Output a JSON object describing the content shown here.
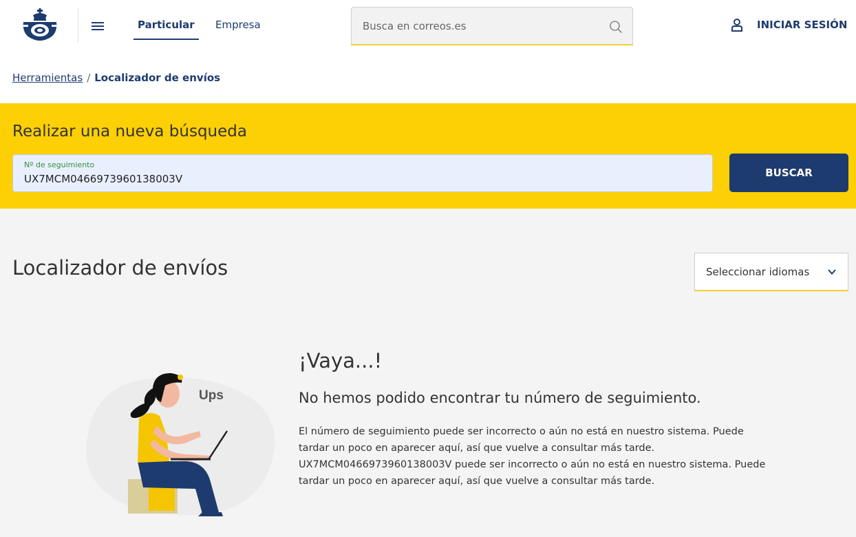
{
  "header": {
    "nav": {
      "particular": "Particular",
      "empresa": "Empresa"
    },
    "search": {
      "placeholder": "Busca en correos.es"
    },
    "login_label": "INICIAR SESIÓN"
  },
  "breadcrumb": {
    "link": "Herramientas",
    "separator": "/",
    "current": "Localizador de envíos"
  },
  "search_panel": {
    "title": "Realizar una nueva búsqueda",
    "field_label": "Nº de seguimiento",
    "field_value": "UX7MCM0466973960138003V",
    "button_label": "BUSCAR"
  },
  "main": {
    "title": "Localizador de envíos",
    "language_select": "Seleccionar idiomas",
    "illustration_text": "Ups",
    "error_heading": "¡Vaya...!",
    "error_subheading": "No hemos podido encontrar tu número de seguimiento.",
    "error_description": "El número de seguimiento puede ser incorrecto o aún no está en nuestro sistema. Puede tardar un poco en aparecer aquí, así que vuelve a consultar más tarde. UX7MCM0466973960138003V puede ser incorrecto o aún no está en nuestro sistema. Puede tardar un poco en aparecer aquí, así que vuelve a consultar más tarde."
  },
  "colors": {
    "brand_yellow": "#fdcf05",
    "brand_blue": "#1d3b6e"
  },
  "icons": [
    "correos-logo",
    "menu-icon",
    "search-icon",
    "user-icon",
    "chevron-down-icon"
  ]
}
